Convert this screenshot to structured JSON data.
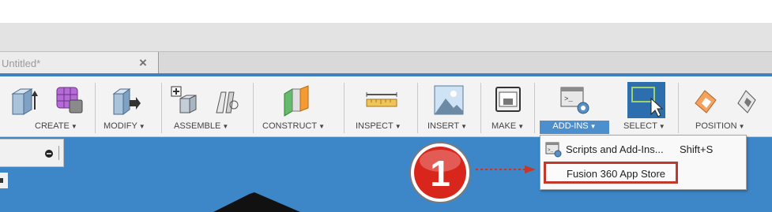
{
  "document_tab": {
    "title": "Untitled*",
    "close_glyph": "×"
  },
  "toolbar": {
    "groups": [
      {
        "label": "CREATE",
        "icon": "box-icon"
      },
      {
        "label": "MODIFY",
        "icon": "modify-icon"
      },
      {
        "label": "ASSEMBLE",
        "icon": "assemble-icon"
      },
      {
        "label": "CONSTRUCT",
        "icon": "construct-plane-icon"
      },
      {
        "label": "INSPECT",
        "icon": "measure-ruler-icon"
      },
      {
        "label": "INSERT",
        "icon": "insert-image-icon"
      },
      {
        "label": "MAKE",
        "icon": "3d-printer-icon"
      },
      {
        "label": "ADD-INS",
        "icon": "scripts-addins-icon"
      },
      {
        "label": "SELECT",
        "icon": "select-cursor-icon"
      },
      {
        "label": "POSITION",
        "icon": "position-icon"
      }
    ],
    "caret": "▼"
  },
  "addins_menu": {
    "items": [
      {
        "label": "Scripts and Add-Ins...",
        "shortcut": "Shift+S"
      },
      {
        "label": "Fusion 360 App Store"
      }
    ]
  },
  "callout": {
    "number": "1"
  },
  "colors": {
    "accent_blue": "#3d87c9",
    "highlight_red": "#c0392b",
    "callout_red": "#d9261c"
  }
}
